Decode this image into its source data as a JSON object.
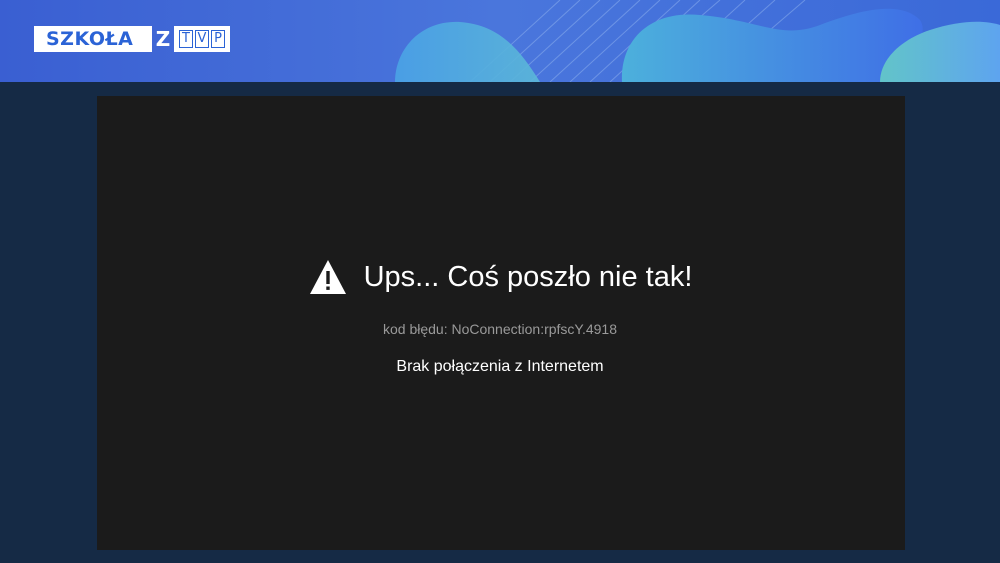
{
  "header": {
    "logo": {
      "szkola_text": "SZKOŁA",
      "z_text": "Z",
      "tvp_letters": [
        "T",
        "V",
        "P"
      ]
    }
  },
  "player": {
    "error": {
      "icon": "warning-icon",
      "title": "Ups... Coś poszło nie tak!",
      "code": "kod błędu: NoConnection:rpfscY.4918",
      "message": "Brak połączenia z Internetem"
    }
  },
  "colors": {
    "header_blue": "#3a5fd2",
    "page_background": "#152a45",
    "player_background": "#1b1b1b",
    "logo_blue": "#2b63d6"
  }
}
